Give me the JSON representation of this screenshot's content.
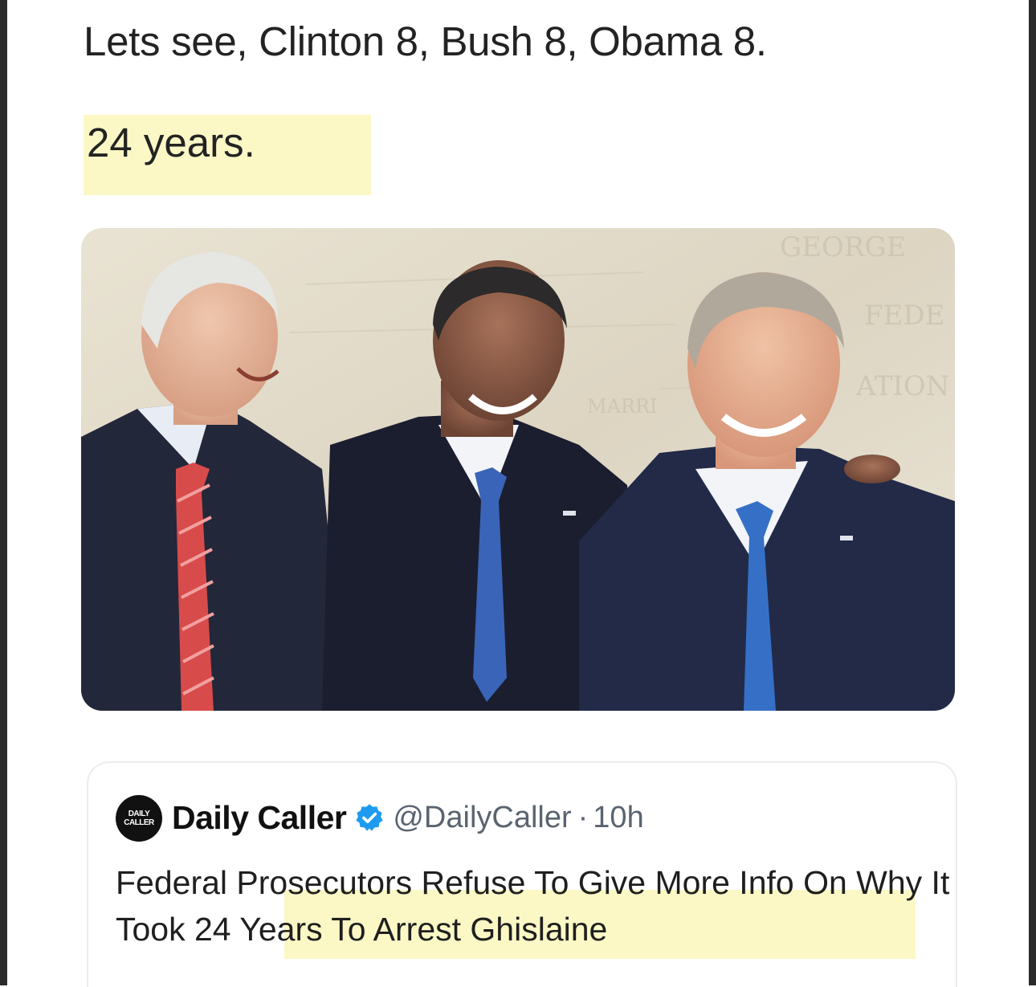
{
  "caption": {
    "line1": "Lets see, Clinton 8, Bush 8, Obama 8.",
    "line2": "24 years."
  },
  "highlight_color": "#fbf8c6",
  "photo": {
    "wall_text": [
      "GEORGE",
      "FEDE",
      "ATION",
      "MARRI"
    ]
  },
  "tweet": {
    "avatar_text": [
      "DAILY",
      "CALLER"
    ],
    "author": "Daily Caller",
    "verified_icon": "verified-badge-icon",
    "verified_color": "#1d9bf0",
    "handle": "@DailyCaller",
    "separator": "·",
    "time": "10h",
    "headline_plain": "Federal Prosecutors Refuse To Give More Info On Why It ",
    "headline_highlight": "Took 24 Years To Arrest Ghislaine"
  }
}
